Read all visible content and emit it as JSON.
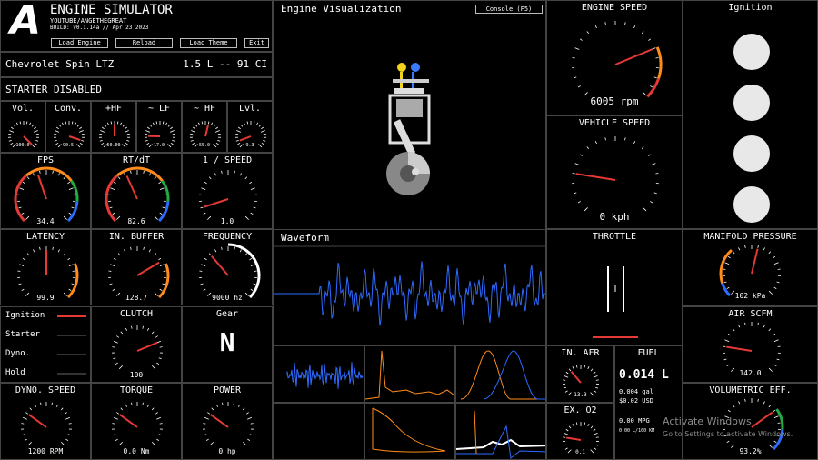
{
  "app": {
    "logo": "A",
    "title": "ENGINE SIMULATOR",
    "channel": "YOUTUBE/ANGETHEGREAT",
    "build": "BUILD: v0.1.14a // Apr 23 2023",
    "buttons": [
      "Load Engine",
      "Reload",
      "Load Theme",
      "Exit"
    ],
    "engine_name": "Chevrolet Spin LTZ",
    "engine_disp": "1.5 L -- 91 CI",
    "starter_status": "STARTER DISABLED"
  },
  "colors": {
    "needle": "#e53935",
    "accent_orange": "#ff8c1a",
    "accent_blue": "#2e6bff",
    "accent_green": "#22aa44",
    "panel_border": "#444"
  },
  "small_gauges": [
    {
      "label": "Vol.",
      "value": "100.0",
      "level": 1.0
    },
    {
      "label": "Conv.",
      "value": "90.5",
      "level": 0.9
    },
    {
      "label": "+HF",
      "value": "50.00",
      "level": 0.5
    },
    {
      "label": "~ LF",
      "value": "17.0",
      "level": 0.17
    },
    {
      "label": "~ HF",
      "value": "55.0",
      "level": 0.55
    },
    {
      "label": "Lvl.",
      "value": "9.3",
      "level": 0.09
    }
  ],
  "perf_gauges": [
    {
      "label": "FPS",
      "value": "34.4",
      "level": 0.43,
      "arc": "multi"
    },
    {
      "label": "RT/dT",
      "value": "82.6",
      "level": 0.41,
      "arc": "multi"
    },
    {
      "label": "1 / SPEED",
      "value": "1.0",
      "level": 0.1,
      "arc": "none"
    },
    {
      "label": "LATENCY",
      "value": "99.9",
      "level": 0.5,
      "arc": "orange"
    },
    {
      "label": "IN. BUFFER",
      "value": "128.7",
      "level": 0.72,
      "arc": "orange"
    },
    {
      "label": "FREQUENCY",
      "value": "9000 hz",
      "level": 0.35,
      "arc": "white"
    }
  ],
  "indicators": {
    "items": [
      {
        "label": "Ignition",
        "on": true
      },
      {
        "label": "Starter",
        "on": false
      },
      {
        "label": "Dyno.",
        "on": false
      },
      {
        "label": "Hold",
        "on": false
      }
    ]
  },
  "clutch": {
    "label": "CLUTCH",
    "value": "100",
    "level": 0.75
  },
  "gear": {
    "label": "Gear",
    "value": "N"
  },
  "bottom_gauges": [
    {
      "label": "DYNO. SPEED",
      "value": "1200 RPM",
      "level": 0.3
    },
    {
      "label": "TORQUE",
      "value": "0.0 Nm",
      "level": 0.3
    },
    {
      "label": "POWER",
      "value": "0 hp",
      "level": 0.3
    }
  ],
  "visualization": {
    "title": "Engine Visualization",
    "console_button": "Console (F5)"
  },
  "waveform": {
    "title": "Waveform"
  },
  "engine_speed": {
    "title": "ENGINE SPEED",
    "value": "6005 rpm",
    "level": 0.75
  },
  "vehicle_speed": {
    "title": "VEHICLE SPEED",
    "value": "0 kph",
    "level": 0.2
  },
  "throttle": {
    "title": "THROTTLE"
  },
  "ignition": {
    "title": "Ignition"
  },
  "manifold": {
    "title": "MANIFOLD PRESSURE",
    "value": "102 kPa",
    "level": 0.55
  },
  "air": {
    "title": "AIR SCFM",
    "value": "142.0",
    "level": 0.2
  },
  "volumetric": {
    "title": "VOLUMETRIC EFF.",
    "value": "93.2%",
    "level": 0.7
  },
  "afr": {
    "title": "IN. AFR",
    "value": "13.3",
    "level": 0.35
  },
  "o2": {
    "title": "EX. O2",
    "value": "0.1",
    "level": 0.2
  },
  "fuel": {
    "title": "FUEL",
    "liters": "0.014 L",
    "gal": "0.004 gal",
    "usd": "$0.02 USD",
    "mpg": "0.00 MPG",
    "l100": "0.00 L/100 KM"
  },
  "watermark": {
    "line1": "Activate Windows",
    "line2": "Go to Settings to activate Windows."
  }
}
